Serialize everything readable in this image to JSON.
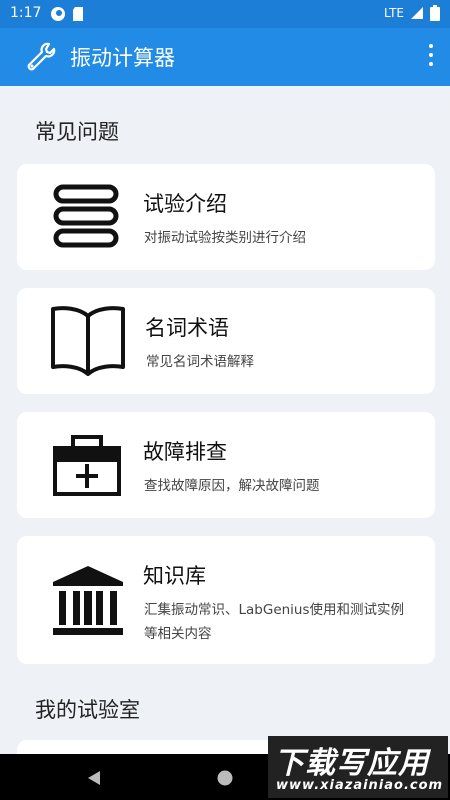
{
  "status_bar": {
    "time": "1:17",
    "network": "LTE"
  },
  "app_bar": {
    "title": "振动计算器",
    "icon": "wrench-icon",
    "menu_icon": "more-vert-icon"
  },
  "sections": {
    "faq_title": "常见问题",
    "lab_title": "我的试验室"
  },
  "cards": [
    {
      "title": "试验介绍",
      "desc": "对振动试验按类别进行介绍",
      "icon": "stack-icon"
    },
    {
      "title": "名词术语",
      "desc": "常见名词术语解释",
      "icon": "book-icon"
    },
    {
      "title": "故障排查",
      "desc": "查找故障原因，解决故障问题",
      "icon": "toolbox-icon"
    },
    {
      "title": "知识库",
      "desc": "汇集振动常识、LabGenius使用和测试实例等相关内容",
      "icon": "library-icon"
    }
  ],
  "watermark": {
    "main": "下载写应用",
    "url": "www.xiazainiao.com"
  },
  "colors": {
    "status_bar": "#1c7ed6",
    "app_bar": "#228be6",
    "background": "#eef1f5",
    "card": "#ffffff"
  }
}
